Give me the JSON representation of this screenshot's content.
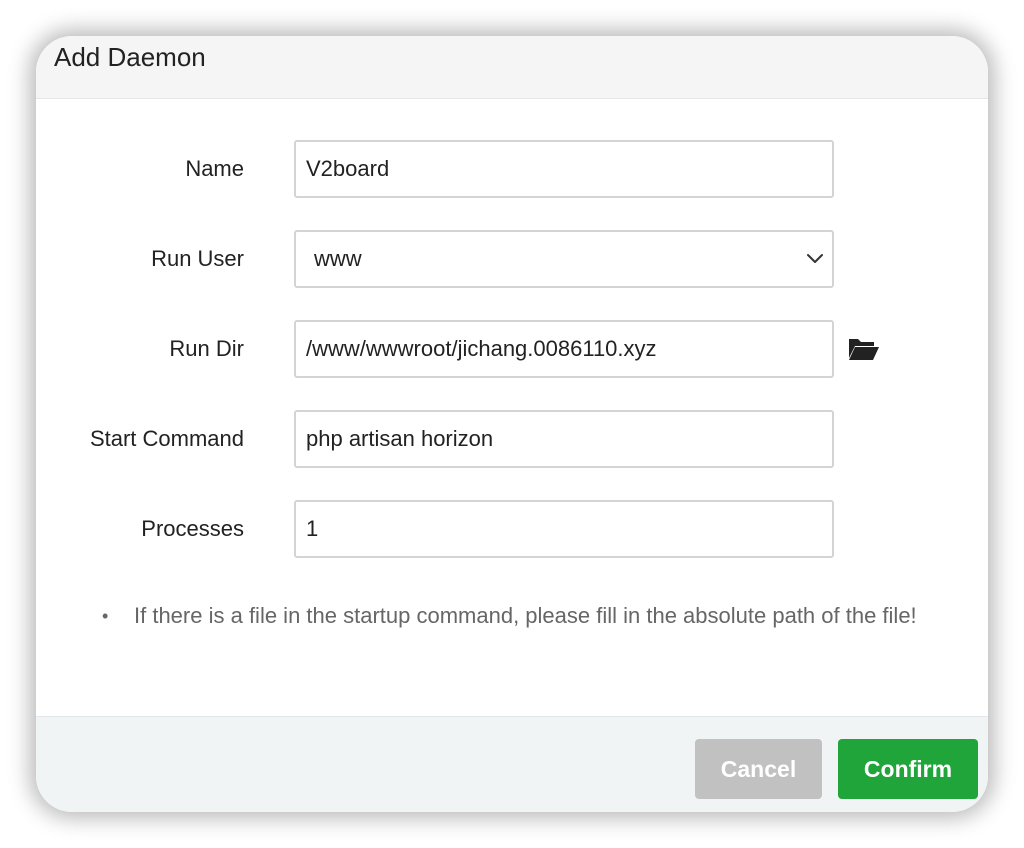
{
  "dialog": {
    "title": "Add Daemon"
  },
  "form": {
    "name": {
      "label": "Name",
      "value": "V2board"
    },
    "run_user": {
      "label": "Run User",
      "value": "www"
    },
    "run_dir": {
      "label": "Run Dir",
      "value": "/www/wwwroot/jichang.0086110.xyz"
    },
    "start_command": {
      "label": "Start Command",
      "value": "php artisan horizon"
    },
    "processes": {
      "label": "Processes",
      "value": "1"
    }
  },
  "note": {
    "bullet": "•",
    "text": "If there is a file in the startup command, please fill in the absolute path of the file!"
  },
  "footer": {
    "cancel_label": "Cancel",
    "confirm_label": "Confirm"
  },
  "colors": {
    "confirm": "#20a53a",
    "cancel": "#c1c1c1",
    "header_bg": "#f5f5f5",
    "footer_bg": "#f1f4f5"
  },
  "icons": {
    "select_arrow": "chevron-down-icon",
    "browse": "folder-open-icon"
  }
}
